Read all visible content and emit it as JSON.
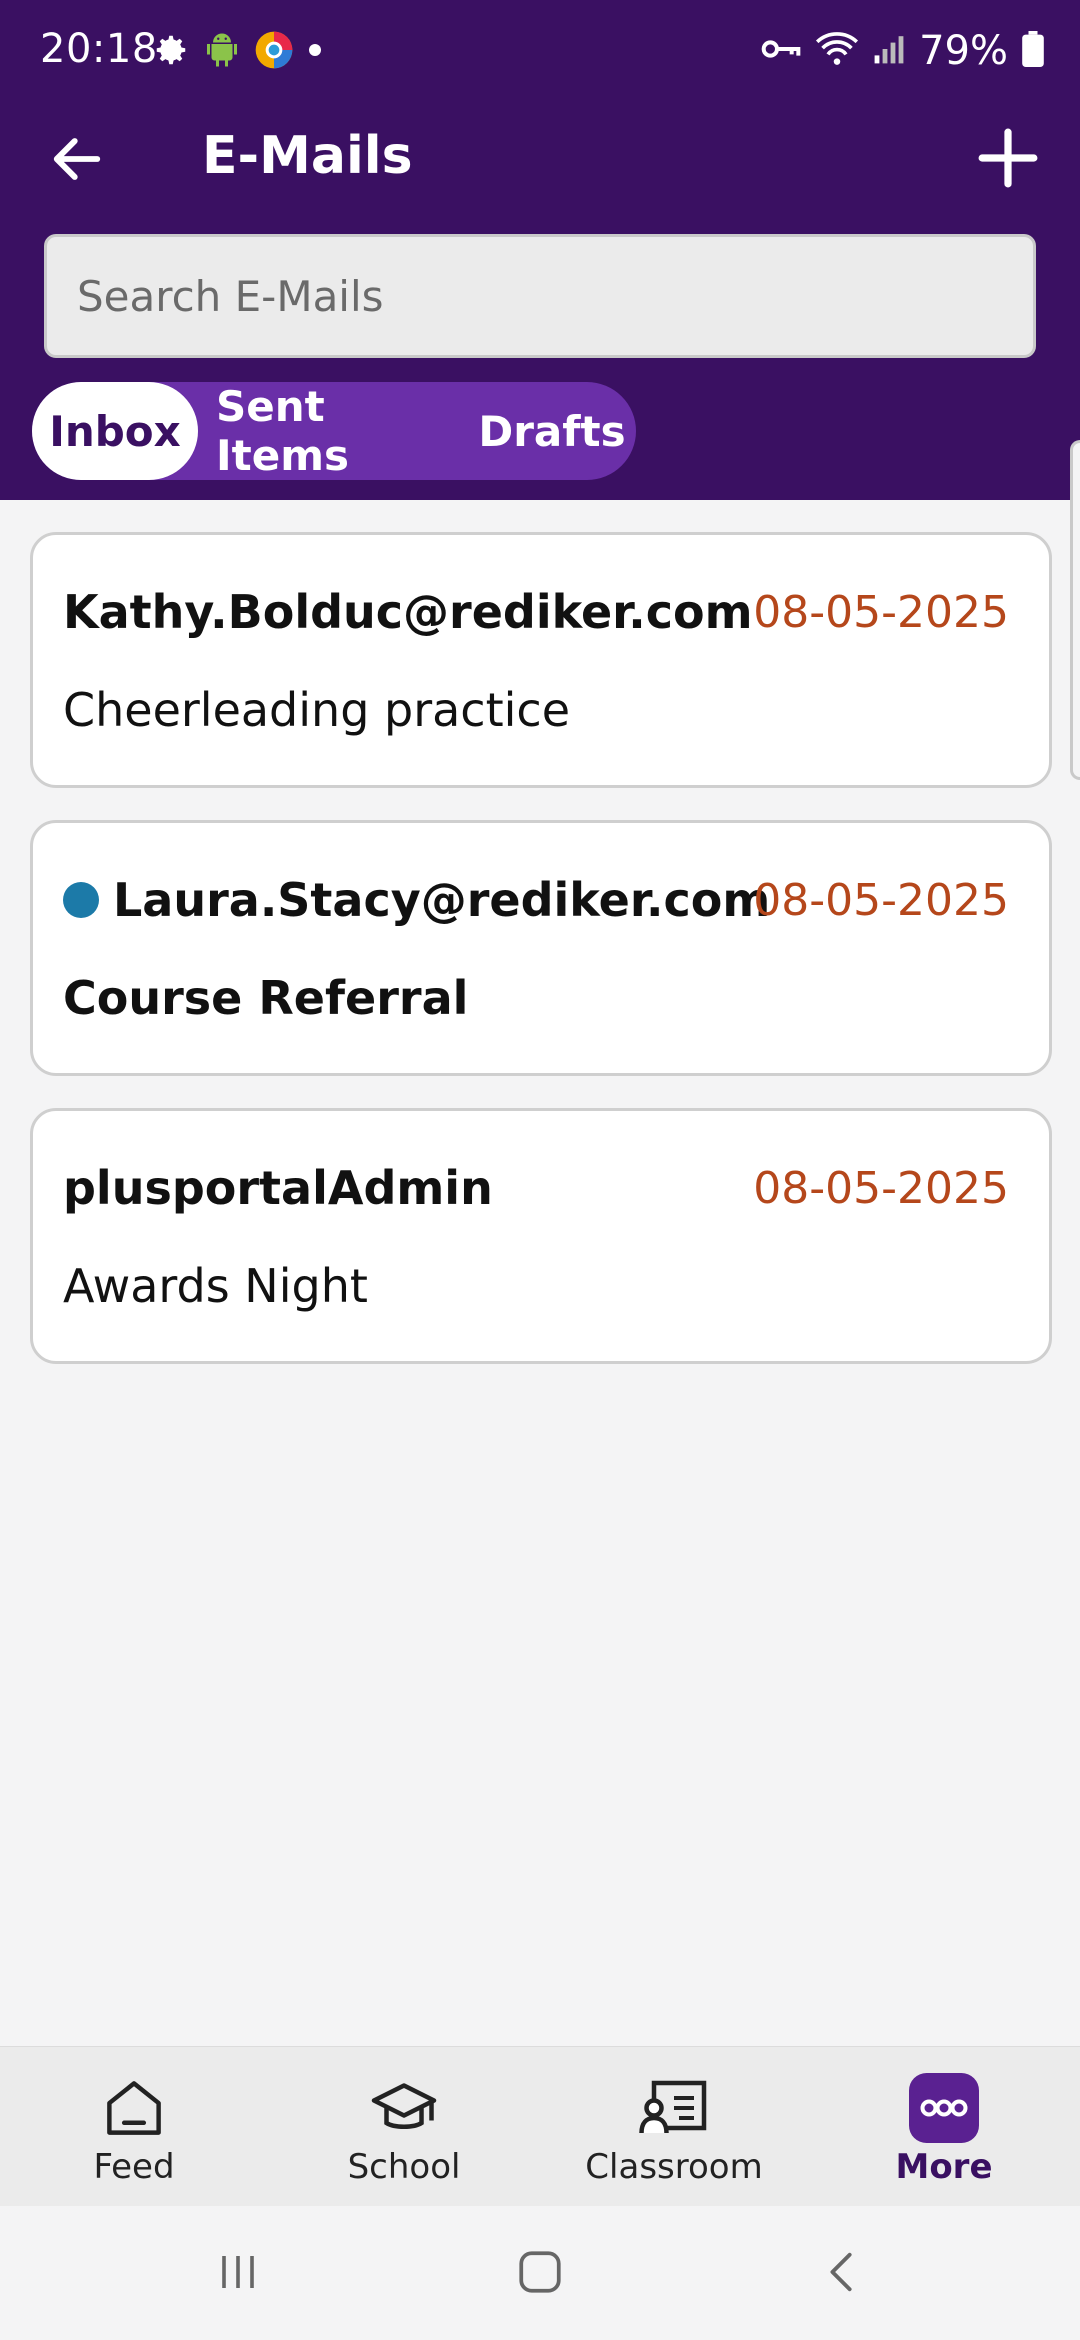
{
  "status_bar": {
    "time": "20:18",
    "battery": "79%",
    "left_icons": [
      "gear-icon",
      "android-icon",
      "chrome-like-icon",
      "dot-icon"
    ],
    "right_icons": [
      "key-icon",
      "wifi-icon",
      "signal-icon",
      "battery-icon"
    ]
  },
  "header": {
    "title": "E-Mails",
    "background": "#3a1062"
  },
  "search": {
    "placeholder": "Search E-Mails",
    "value": ""
  },
  "tabs": [
    {
      "label": "Inbox",
      "active": true
    },
    {
      "label": "Sent Items",
      "active": false
    },
    {
      "label": "Drafts",
      "active": false
    }
  ],
  "emails": [
    {
      "sender": "Kathy.Bolduc@rediker.com",
      "date": "08-05-2025",
      "subject": "Cheerleading practice",
      "unread": false
    },
    {
      "sender": "Laura.Stacy@rediker.com",
      "date": "08-05-2025",
      "subject": "Course Referral",
      "unread": true
    },
    {
      "sender": "plusportalAdmin",
      "date": "08-05-2025",
      "subject": "Awards Night",
      "unread": false
    }
  ],
  "bottom_nav": [
    {
      "label": "Feed",
      "icon": "home-icon",
      "active": false
    },
    {
      "label": "School",
      "icon": "graduation-cap-icon",
      "active": false
    },
    {
      "label": "Classroom",
      "icon": "classroom-board-icon",
      "active": false
    },
    {
      "label": "More",
      "icon": "more-dots-icon",
      "active": true
    }
  ],
  "colors": {
    "accent": "#3a1062",
    "tab_pill": "#6a2fa8",
    "date": "#b5471b",
    "unread_dot": "#1c7aa8"
  }
}
